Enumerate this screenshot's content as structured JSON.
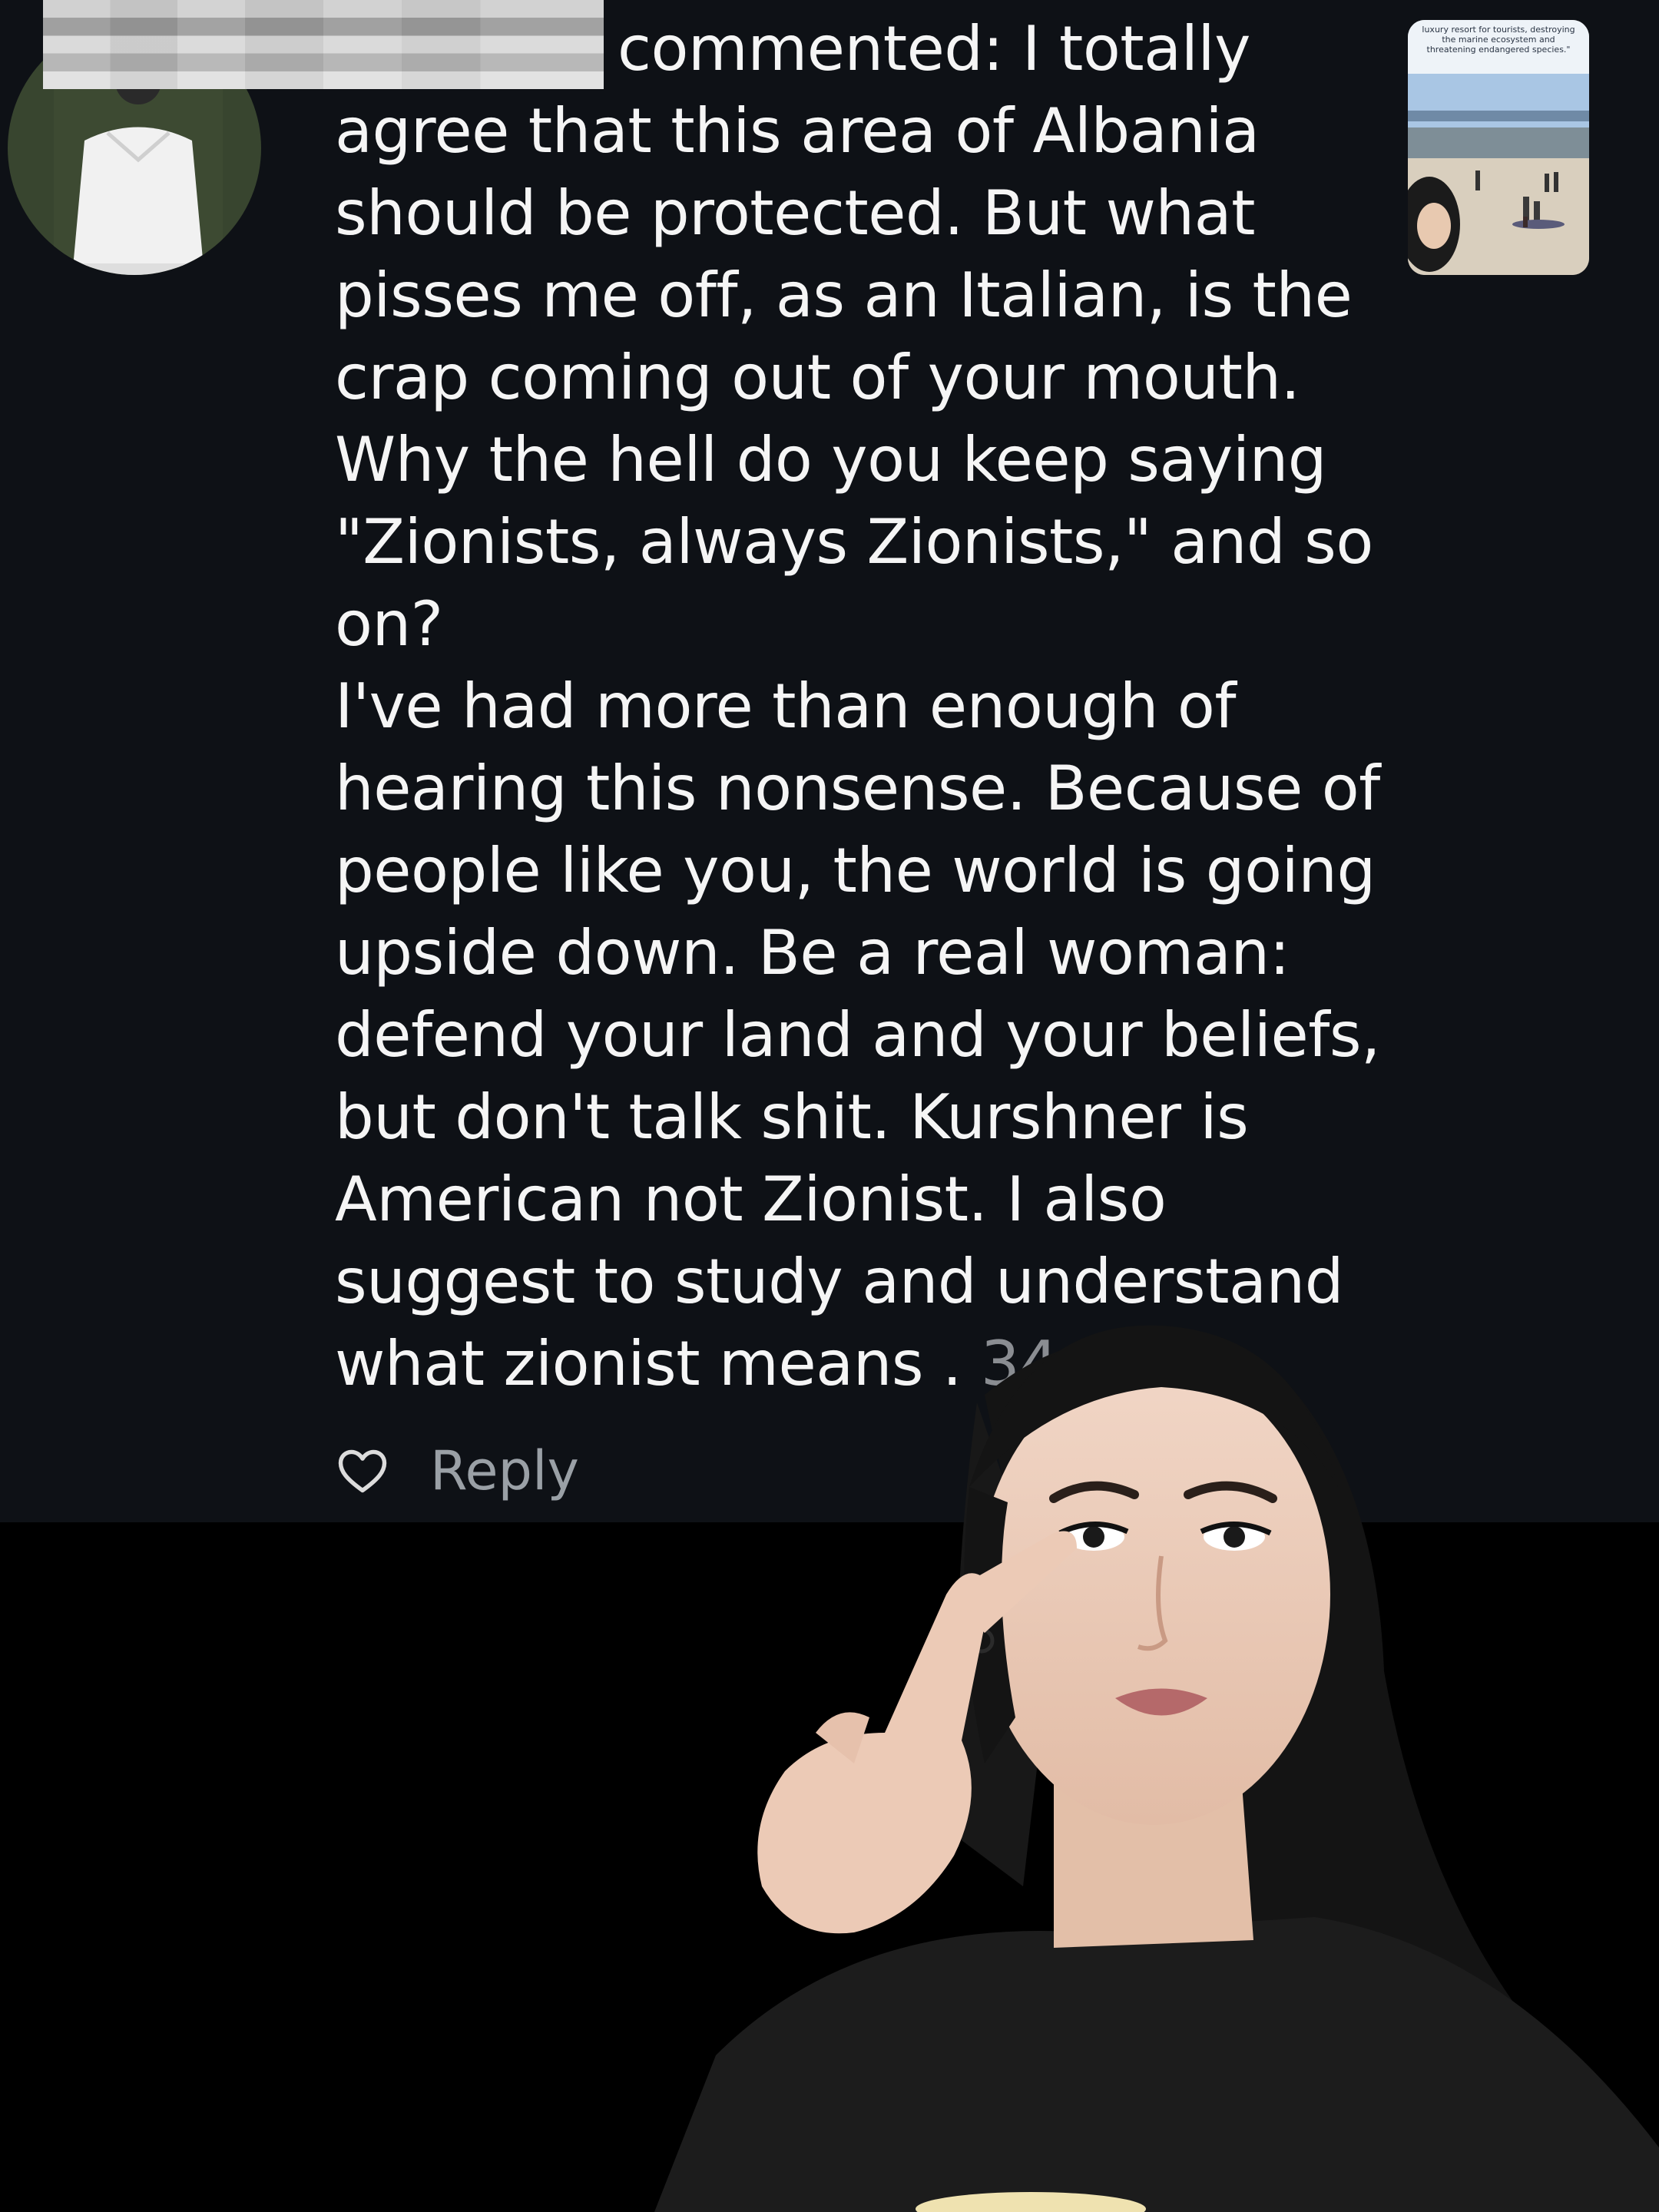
{
  "comment": {
    "lines": [
      "commented: I totally",
      "agree that this area of Albania",
      "should be protected. But what",
      "pisses me off, as an Italian, is the",
      "crap coming out of your mouth.",
      "Why the hell do you keep saying",
      "\"Zionists, always Zionists,\" and so",
      "on?",
      "I've had more than enough of",
      "hearing this nonsense. Because of",
      "people like you, the world is going",
      "upside down. Be a real woman:",
      "defend your land and your beliefs,",
      "but don't talk shit. Kurshner is",
      "American not Zionist. I also",
      "suggest to study and understand",
      "what zionist means ."
    ],
    "timestamp": "34"
  },
  "actions": {
    "reply_label": "Reply",
    "like_icon": "heart-outline-icon"
  },
  "thumbnail": {
    "caption": "luxury resort for tourists, destroying\nthe marine ecosystem and\nthreatening endangered species.\""
  },
  "colors": {
    "panel_background": "#0e1116",
    "page_background": "#000000",
    "text": "#f5f5f5",
    "muted": "#9aa0a6"
  }
}
